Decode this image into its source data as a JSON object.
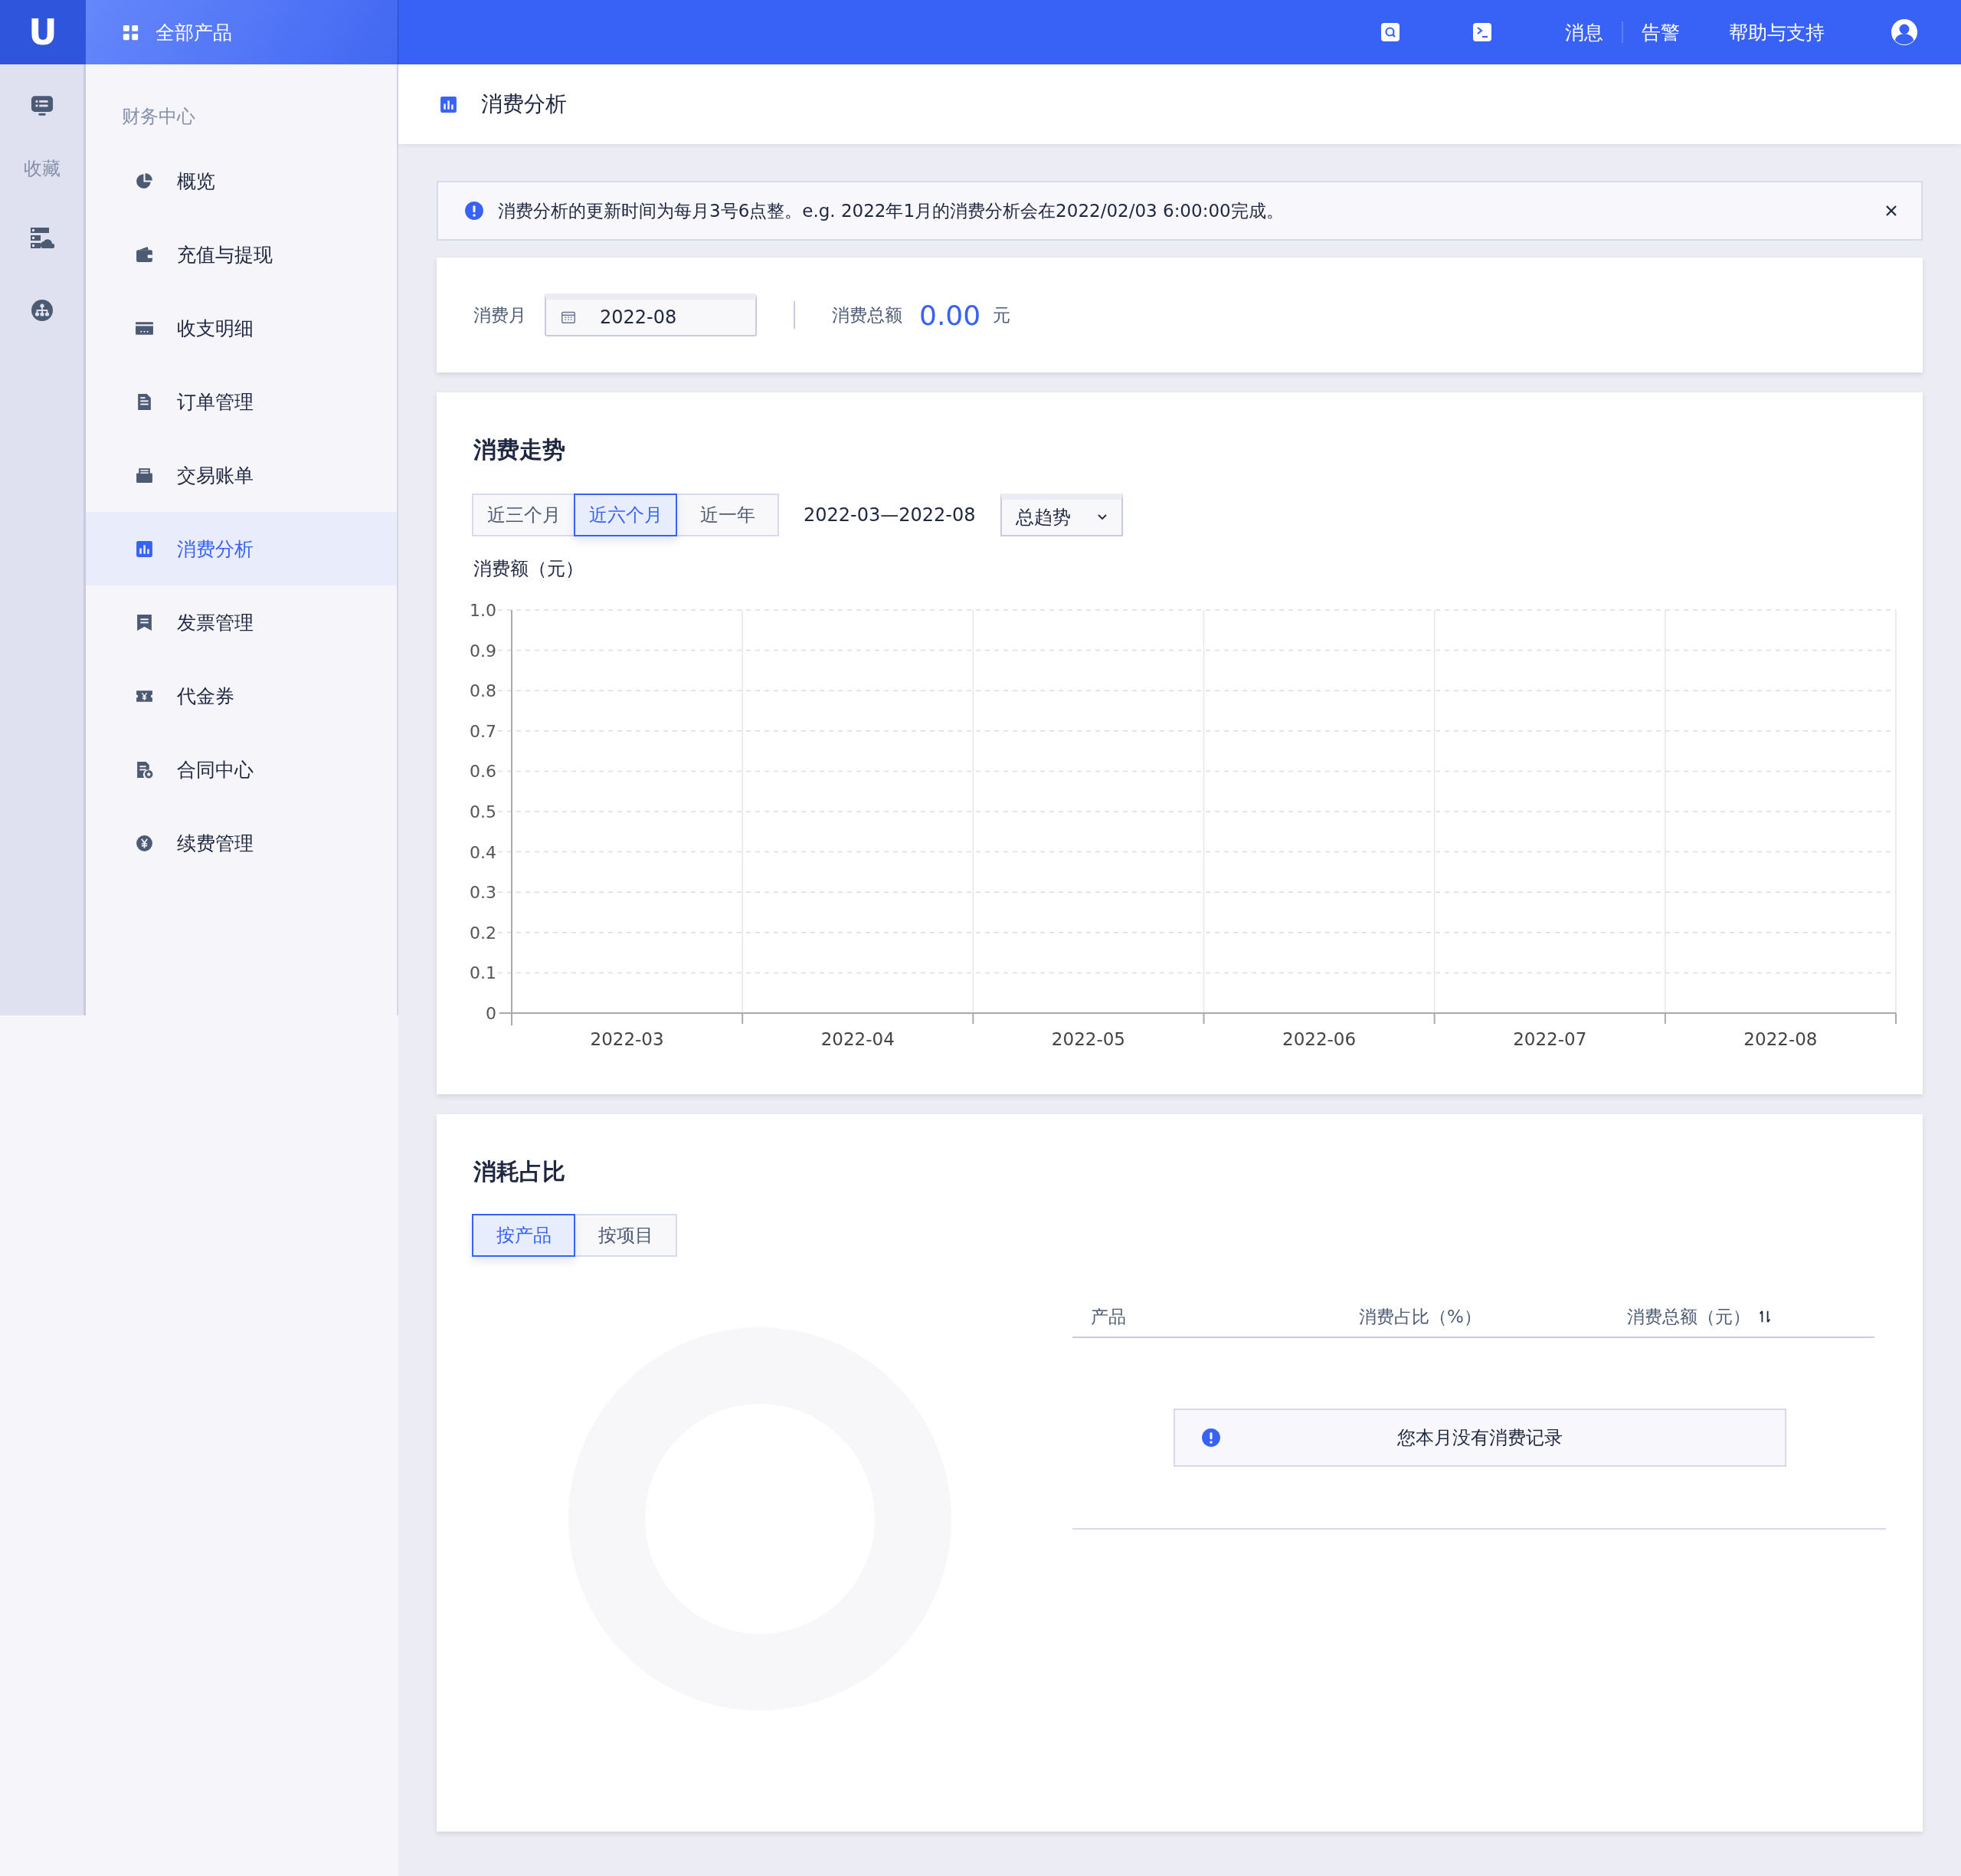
{
  "top_bar": {
    "logo": "U",
    "products_button": "全部产品",
    "links": [
      "消息",
      "告警",
      "帮助与支持"
    ]
  },
  "rail": {
    "label": "收藏"
  },
  "sidebar": {
    "section": "财务中心",
    "items": [
      {
        "label": "概览",
        "kind": "pie",
        "selected": false
      },
      {
        "label": "充值与提现",
        "kind": "wallet",
        "selected": false
      },
      {
        "label": "收支明细",
        "kind": "card",
        "selected": false
      },
      {
        "label": "订单管理",
        "kind": "doc",
        "selected": false
      },
      {
        "label": "交易账单",
        "kind": "bill",
        "selected": false
      },
      {
        "label": "消费分析",
        "kind": "chart",
        "selected": true
      },
      {
        "label": "发票管理",
        "kind": "invoice",
        "selected": false
      },
      {
        "label": "代金券",
        "kind": "voucher",
        "selected": false
      },
      {
        "label": "合同中心",
        "kind": "contract",
        "selected": false
      },
      {
        "label": "续费管理",
        "kind": "yen",
        "selected": false
      }
    ]
  },
  "page_title": "消费分析",
  "notice": {
    "text": "消费分析的更新时间为每月3号6点整。e.g. 2022年1月的消费分析会在2022/02/03 6:00:00完成。"
  },
  "filter": {
    "month_label": "消费月",
    "month_value": "2022-08",
    "total_label": "消费总额",
    "total_value": "0.00",
    "total_unit": "元"
  },
  "trend": {
    "title": "消费走势",
    "ranges": [
      {
        "label": "近三个月",
        "selected": false
      },
      {
        "label": "近六个月",
        "selected": true
      },
      {
        "label": "近一年",
        "selected": false
      }
    ],
    "date_range": "2022-03—2022-08",
    "mode_select": "总趋势",
    "chart_data": {
      "type": "line",
      "grid": true,
      "ylabel": "消费额（元）",
      "categories": [
        "2022-03",
        "2022-04",
        "2022-05",
        "2022-06",
        "2022-07",
        "2022-08"
      ],
      "ylim": [
        0,
        1
      ],
      "yticks": [
        0,
        0.1,
        0.2,
        0.3,
        0.4,
        0.5,
        0.6,
        0.7,
        0.8,
        0.9,
        {
          "value": 1,
          "label": "1.0"
        }
      ]
    }
  },
  "share": {
    "title": "消耗占比",
    "tabs": [
      {
        "label": "按产品",
        "selected": true
      },
      {
        "label": "按项目",
        "selected": false
      }
    ],
    "table": {
      "columns": [
        {
          "label": "产品",
          "sortable": false
        },
        {
          "label": "消费占比（%）",
          "sortable": false
        },
        {
          "label": "消费总额（元）",
          "sortable": true
        }
      ],
      "empty_text": "您本月没有消费记录"
    }
  }
}
